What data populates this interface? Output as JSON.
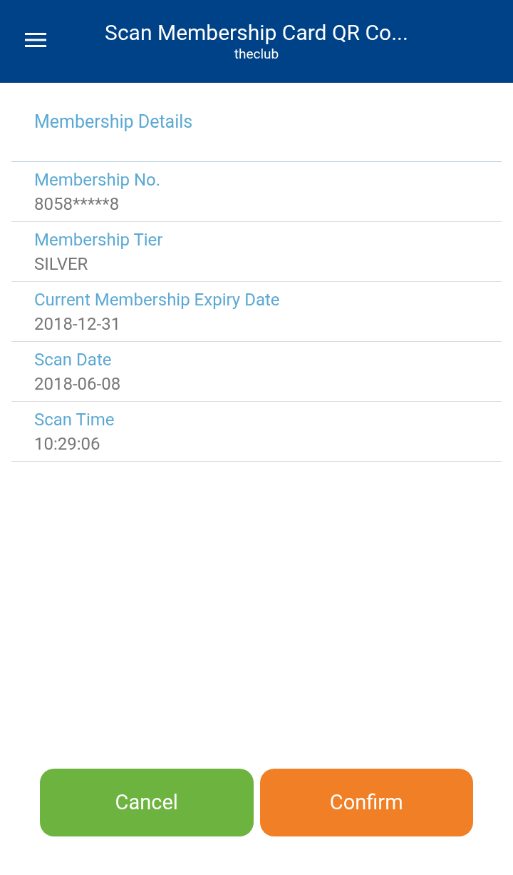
{
  "header": {
    "title": "Scan Membership Card QR Co...",
    "subtitle": "theclub"
  },
  "section": {
    "title": "Membership Details"
  },
  "fields": [
    {
      "label": "Membership No.",
      "value": "8058*****8"
    },
    {
      "label": "Membership Tier",
      "value": "SILVER"
    },
    {
      "label": "Current Membership Expiry Date",
      "value": "2018-12-31"
    },
    {
      "label": "Scan Date",
      "value": "2018-06-08"
    },
    {
      "label": "Scan Time",
      "value": "10:29:06"
    }
  ],
  "buttons": [
    {
      "label": "Cancel",
      "color": "#6db33f"
    },
    {
      "label": "Confirm",
      "color": "#f07f26"
    }
  ]
}
